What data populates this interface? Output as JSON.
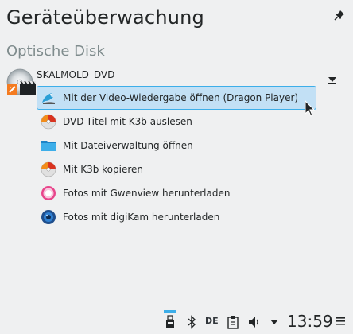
{
  "header": {
    "title": "Geräteüberwachung",
    "section_label": "Optische Disk",
    "pin_icon": "pin-icon"
  },
  "device": {
    "name": "SKALMOLD_DVD",
    "icon": "dvd-media-icon",
    "expand_icon": "triangle-down-icon"
  },
  "actions": [
    {
      "label": "Mit der Video-Wiedergabe öffnen (Dragon Player)",
      "icon": "dragon-player-icon",
      "hovered": true
    },
    {
      "label": "DVD-Titel mit K3b auslesen",
      "icon": "k3b-icon",
      "hovered": false
    },
    {
      "label": "Mit Dateiverwaltung öffnen",
      "icon": "folder-icon",
      "hovered": false
    },
    {
      "label": "Mit K3b kopieren",
      "icon": "k3b-icon",
      "hovered": false
    },
    {
      "label": "Fotos mit Gwenview herunterladen",
      "icon": "gwenview-icon",
      "hovered": false
    },
    {
      "label": "Fotos mit digiKam herunterladen",
      "icon": "digikam-icon",
      "hovered": false
    }
  ],
  "taskbar": {
    "language": "DE",
    "clock": "13:59",
    "tray_icons": [
      "usb-device-icon",
      "bluetooth-icon",
      "clipboard-icon",
      "volume-icon",
      "chevron-down-icon",
      "hamburger-menu-icon"
    ]
  },
  "colors": {
    "accent": "#3daee9",
    "hover_bg": "#c2e0f5",
    "background": "#eff0f1"
  }
}
